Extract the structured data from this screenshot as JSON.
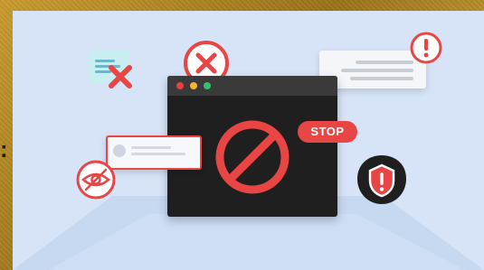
{
  "stop_label": "STOP",
  "colors": {
    "panel_background": "#d7e4f7",
    "browser_body": "#1f1f1f",
    "alert_red": "#e84545",
    "gold_frame": "#b48a24"
  },
  "icons": [
    "ban-icon",
    "close-icon",
    "alert-icon",
    "eye-off-icon",
    "shield-alert-icon",
    "chat-icon"
  ]
}
